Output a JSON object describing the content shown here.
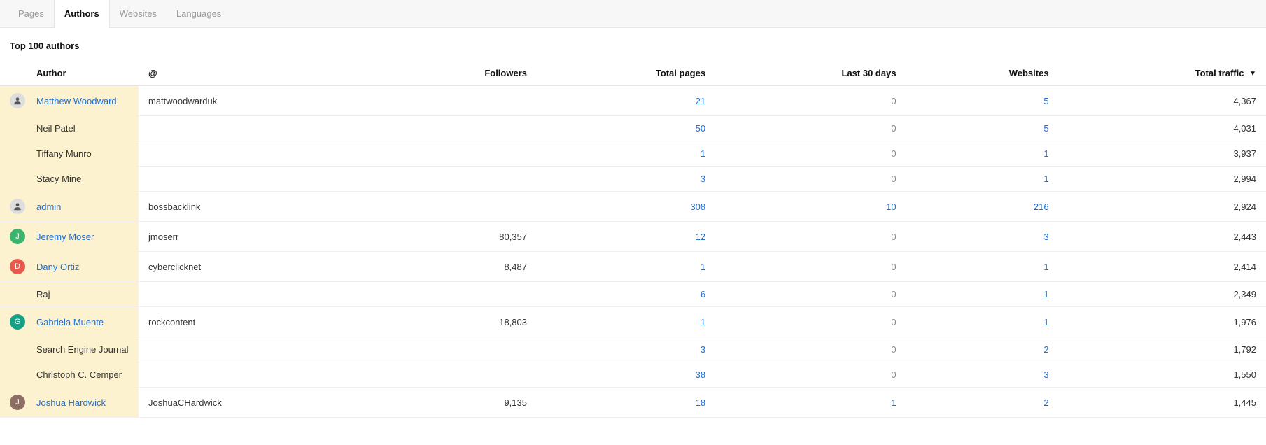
{
  "tabs": [
    {
      "label": "Pages",
      "active": false
    },
    {
      "label": "Authors",
      "active": true
    },
    {
      "label": "Websites",
      "active": false
    },
    {
      "label": "Languages",
      "active": false
    }
  ],
  "heading": "Top 100 authors",
  "columns": {
    "author": "Author",
    "handle": "@",
    "followers": "Followers",
    "total_pages": "Total pages",
    "last_30": "Last 30 days",
    "websites": "Websites",
    "total_traffic": "Total traffic"
  },
  "sort_indicator": "▼",
  "rows": [
    {
      "name": "Matthew Woodward",
      "name_link": true,
      "handle": "mattwoodwarduk",
      "followers": "",
      "total_pages": "21",
      "last_30": "0",
      "websites": "5",
      "total_traffic": "4,367",
      "highlight": true,
      "avatar": "person"
    },
    {
      "name": "Neil Patel",
      "name_link": false,
      "handle": "",
      "followers": "",
      "total_pages": "50",
      "last_30": "0",
      "websites": "5",
      "total_traffic": "4,031",
      "highlight": true,
      "avatar": ""
    },
    {
      "name": "Tiffany Munro",
      "name_link": false,
      "handle": "",
      "followers": "",
      "total_pages": "1",
      "last_30": "0",
      "websites": "1",
      "total_traffic": "3,937",
      "highlight": true,
      "avatar": ""
    },
    {
      "name": "Stacy Mine",
      "name_link": false,
      "handle": "",
      "followers": "",
      "total_pages": "3",
      "last_30": "0",
      "websites": "1",
      "total_traffic": "2,994",
      "highlight": true,
      "avatar": ""
    },
    {
      "name": "admin",
      "name_link": true,
      "handle": "bossbacklink",
      "followers": "",
      "total_pages": "308",
      "last_30": "10",
      "websites": "216",
      "total_traffic": "2,924",
      "highlight": true,
      "avatar": "person"
    },
    {
      "name": "Jeremy Moser",
      "name_link": true,
      "handle": "jmoserr",
      "followers": "80,357",
      "total_pages": "12",
      "last_30": "0",
      "websites": "3",
      "total_traffic": "2,443",
      "highlight": true,
      "avatar": "green"
    },
    {
      "name": "Dany Ortiz",
      "name_link": true,
      "handle": "cyberclicknet",
      "followers": "8,487",
      "total_pages": "1",
      "last_30": "0",
      "websites": "1",
      "total_traffic": "2,414",
      "highlight": true,
      "avatar": "red"
    },
    {
      "name": "Raj",
      "name_link": false,
      "handle": "",
      "followers": "",
      "total_pages": "6",
      "last_30": "0",
      "websites": "1",
      "total_traffic": "2,349",
      "highlight": true,
      "avatar": ""
    },
    {
      "name": "Gabriela Muente",
      "name_link": true,
      "handle": "rockcontent",
      "followers": "18,803",
      "total_pages": "1",
      "last_30": "0",
      "websites": "1",
      "total_traffic": "1,976",
      "highlight": true,
      "avatar": "teal"
    },
    {
      "name": "Search Engine Journal",
      "name_link": false,
      "handle": "",
      "followers": "",
      "total_pages": "3",
      "last_30": "0",
      "websites": "2",
      "total_traffic": "1,792",
      "highlight": true,
      "avatar": ""
    },
    {
      "name": "Christoph C. Cemper",
      "name_link": false,
      "handle": "",
      "followers": "",
      "total_pages": "38",
      "last_30": "0",
      "websites": "3",
      "total_traffic": "1,550",
      "highlight": true,
      "avatar": ""
    },
    {
      "name": "Joshua Hardwick",
      "name_link": true,
      "handle": "JoshuaCHardwick",
      "followers": "9,135",
      "total_pages": "18",
      "last_30": "1",
      "websites": "2",
      "total_traffic": "1,445",
      "highlight": true,
      "avatar": "brown"
    }
  ]
}
